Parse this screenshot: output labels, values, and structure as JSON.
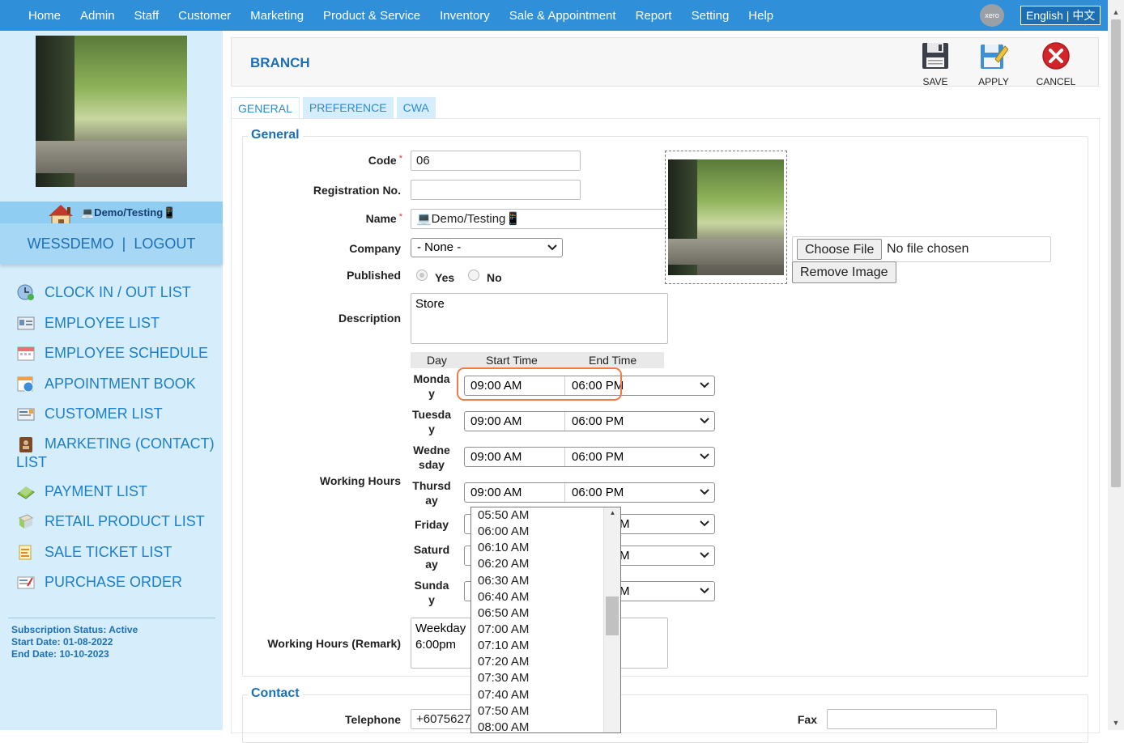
{
  "topnav": {
    "items": [
      "Home",
      "Admin",
      "Staff",
      "Customer",
      "Marketing",
      "Product & Service",
      "Inventory",
      "Sale & Appointment",
      "Report",
      "Setting",
      "Help"
    ],
    "xero_label": "xero",
    "language_label": "English | 中文"
  },
  "sidebar": {
    "branch_name": "💻Demo/Testing📱",
    "username": "WESSDEMO",
    "separator": "|",
    "logout": "LOGOUT",
    "menu": [
      {
        "label": "CLOCK IN / OUT LIST",
        "icon": "clock-globe-icon"
      },
      {
        "label": "EMPLOYEE LIST",
        "icon": "employee-card-icon"
      },
      {
        "label": "EMPLOYEE SCHEDULE",
        "icon": "calendar-icon"
      },
      {
        "label": "APPOINTMENT BOOK",
        "icon": "appointment-icon"
      },
      {
        "label": "CUSTOMER LIST",
        "icon": "customer-card-icon"
      },
      {
        "label_line1": "MARKETING (CONTACT)",
        "label_line2": "LIST",
        "icon": "contact-book-icon"
      },
      {
        "label": "PAYMENT LIST",
        "icon": "money-icon"
      },
      {
        "label": "RETAIL PRODUCT LIST",
        "icon": "box-icon"
      },
      {
        "label": "SALE TICKET LIST",
        "icon": "ticket-icon"
      },
      {
        "label": "PURCHASE ORDER",
        "icon": "purchase-order-icon"
      }
    ],
    "subscription": {
      "status": "Subscription Status: Active",
      "start": "Start Date: 01-08-2022",
      "end": "End Date: 10-10-2023"
    }
  },
  "header": {
    "title": "BRANCH",
    "save": "SAVE",
    "apply": "APPLY",
    "cancel": "CANCEL"
  },
  "tabs": [
    "GENERAL",
    "PREFERENCE",
    "CWA"
  ],
  "general": {
    "legend": "General",
    "code_label": "Code",
    "code_value": "06",
    "reg_label": "Registration No.",
    "reg_value": "",
    "name_label": "Name",
    "name_value": "💻Demo/Testing📱",
    "company_label": "Company",
    "company_value": "- None -",
    "published_label": "Published",
    "yes": "Yes",
    "no": "No",
    "desc_label": "Description",
    "desc_value": "Store",
    "choose_file": "Choose File",
    "no_file": "No file chosen",
    "remove_image": "Remove Image",
    "working_hours_label": "Working Hours",
    "wh_headers": {
      "day": "Day",
      "start": "Start Time",
      "end": "End Time"
    },
    "days": [
      {
        "line1": "Monda",
        "line2": "y",
        "start": "09:00 AM",
        "end": "06:00 PM"
      },
      {
        "line1": "Tuesda",
        "line2": "y",
        "start": "09:00 AM",
        "end": "06:00 PM"
      },
      {
        "line1": "Wedne",
        "line2": "sday",
        "start": "09:00 AM",
        "end": "06:00 PM"
      },
      {
        "line1": "Thursd",
        "line2": "ay",
        "start": "09:00 AM",
        "end": "06:00 PM"
      },
      {
        "line1": "Friday",
        "line2": "",
        "end_visible": "M"
      },
      {
        "line1": "Saturd",
        "line2": "ay",
        "end_visible": "M"
      },
      {
        "line1": "Sunda",
        "line2": "y",
        "end_visible": "M"
      }
    ],
    "remark_label": "Working Hours (Remark)",
    "remark_line1": "Weekday",
    "remark_line2": "6:00pm"
  },
  "time_dropdown": [
    "05:50 AM",
    "06:00 AM",
    "06:10 AM",
    "06:20 AM",
    "06:30 AM",
    "06:40 AM",
    "06:50 AM",
    "07:00 AM",
    "07:10 AM",
    "07:20 AM",
    "07:30 AM",
    "07:40 AM",
    "07:50 AM",
    "08:00 AM"
  ],
  "contact": {
    "legend": "Contact",
    "telephone_label": "Telephone",
    "telephone_value": "+6075627",
    "fax_label": "Fax",
    "fax_value": ""
  },
  "colors": {
    "nav_bg": "#2f8fd8",
    "sidebar_bg": "#d6edfb",
    "accent": "#1d6fb5",
    "highlight": "#f07a48"
  }
}
